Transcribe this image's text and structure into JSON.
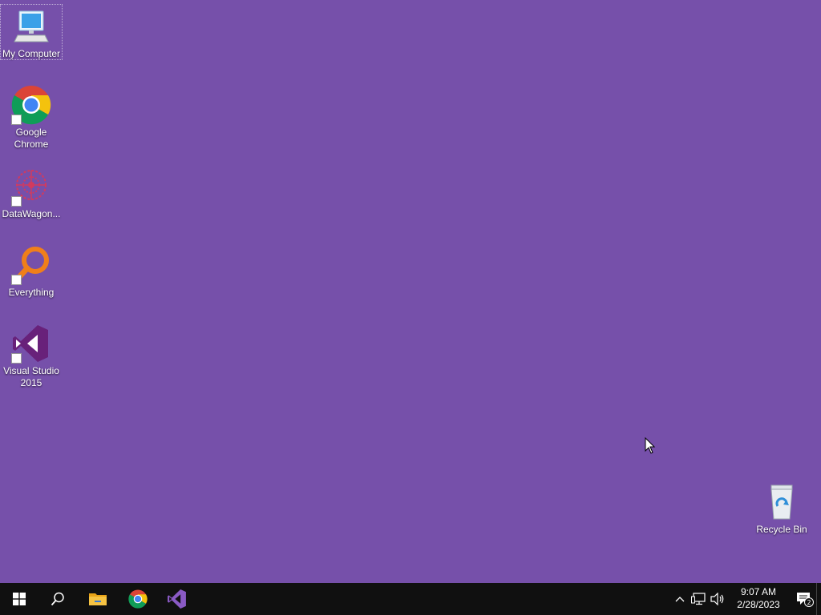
{
  "desktop": {
    "background_color": "#7650aa",
    "icons": [
      {
        "label": "My Computer",
        "icon": "computer-icon"
      },
      {
        "label": "Google\nChrome",
        "icon": "chrome-icon"
      },
      {
        "label": "DataWagon...",
        "icon": "datawagon-icon"
      },
      {
        "label": "Everything",
        "icon": "everything-search-icon"
      },
      {
        "label": "Visual Studio\n2015",
        "icon": "visual-studio-icon"
      },
      {
        "label": "Recycle Bin",
        "icon": "recycle-bin-icon"
      }
    ]
  },
  "taskbar": {
    "background_color": "#101010",
    "pinned": [
      {
        "name": "start",
        "icon": "windows-logo-icon"
      },
      {
        "name": "search",
        "icon": "search-icon"
      },
      {
        "name": "file-explorer",
        "icon": "folder-icon"
      },
      {
        "name": "chrome",
        "icon": "chrome-icon"
      },
      {
        "name": "visual-studio",
        "icon": "visual-studio-icon"
      }
    ],
    "tray": {
      "icons": [
        "chevron-up-icon",
        "network-icon",
        "volume-icon"
      ],
      "time": "9:07 AM",
      "date": "2/28/2023",
      "notification_count": "2"
    }
  }
}
